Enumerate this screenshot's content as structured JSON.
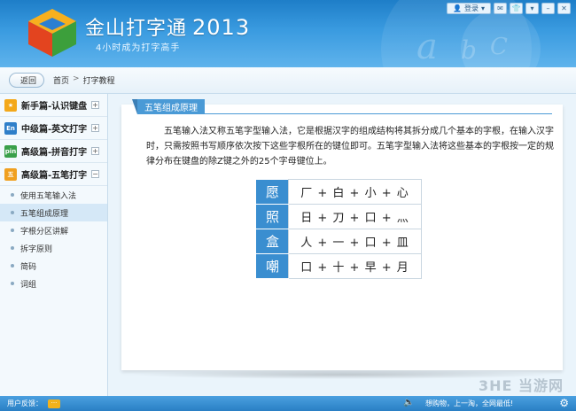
{
  "header": {
    "title": "金山打字通",
    "year": "2013",
    "slogan": "4小时成为打字高手",
    "login_label": "登录"
  },
  "breadcrumb": {
    "back_label": "返回",
    "home": "首页",
    "separator": ">",
    "current": "打字教程"
  },
  "sidebar": {
    "categories": [
      {
        "icon": "★",
        "label": "新手篇-认识键盘",
        "toggle": "+",
        "color": "#f3a81a"
      },
      {
        "icon": "En",
        "label": "中级篇-英文打字",
        "toggle": "+",
        "color": "#2f7fc9"
      },
      {
        "icon": "pin",
        "label": "高级篇-拼音打字",
        "toggle": "+",
        "color": "#3aa04a"
      },
      {
        "icon": "五",
        "label": "高级篇-五笔打字",
        "toggle": "−",
        "color": "#f0a020"
      }
    ],
    "subitems": [
      "使用五笔输入法",
      "五笔组成原理",
      "字根分区讲解",
      "拆字原则",
      "简码",
      "词组"
    ],
    "active_sub": 1
  },
  "content": {
    "tab_title": "五笔组成原理",
    "intro": "五笔输入法又称五笔字型输入法，它是根据汉字的组成结构将其拆分成几个基本的字根，在输入汉字时，只需按照书写顺序依次按下这些字根所在的键位即可。五笔字型输入法将这些基本的字根按一定的规律分布在键盘的除Z键之外的25个字母键位上。",
    "table": [
      {
        "char": "愿",
        "parts": "厂 + 白 + 小 + 心"
      },
      {
        "char": "照",
        "parts": "日 + 刀 + 口 + 灬"
      },
      {
        "char": "盒",
        "parts": "人 + 一 + 口 + 皿"
      },
      {
        "char": "嘲",
        "parts": "口 + 十 + 早 + 月"
      }
    ]
  },
  "footer": {
    "feedback_label": "用户反馈：",
    "feedback_btn": "···",
    "marquee": "想购物，上一淘，全网最低!"
  },
  "watermark": "3HE 当游网",
  "icons": {
    "sound": "speaker-icon",
    "settings": "gear-icon"
  }
}
